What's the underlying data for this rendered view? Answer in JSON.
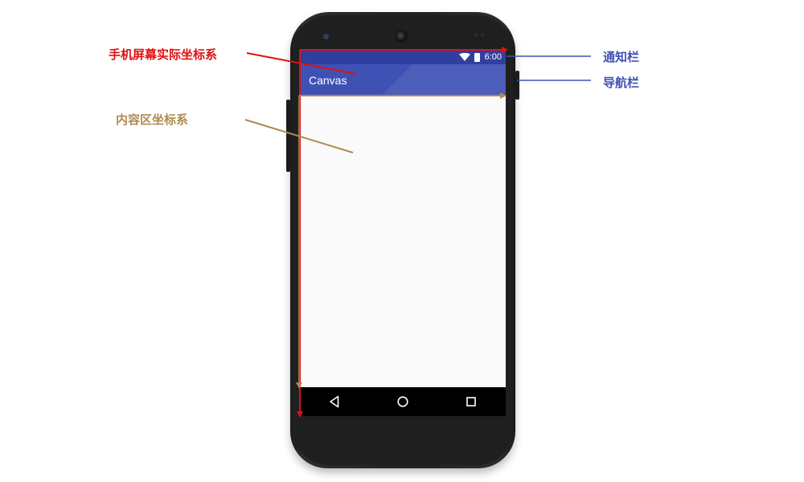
{
  "annotations": {
    "screen_coordinate_system": "手机屏幕实际坐标系",
    "content_coordinate_system": "内容区坐标系",
    "notification_bar": "通知栏",
    "navigation_bar": "导航栏"
  },
  "phone": {
    "status_bar": {
      "time": "6:00",
      "icons": [
        "wifi-icon",
        "battery-icon"
      ]
    },
    "toolbar": {
      "title": "Canvas"
    },
    "nav_bar": {
      "buttons": [
        "back-icon",
        "home-icon",
        "recents-icon"
      ]
    }
  },
  "colors": {
    "screen_axis": "#e01010",
    "content_axis": "#b08a50",
    "bar_label": "#3f51b5",
    "status_bar": "#303f9f",
    "toolbar": "#3f51b5"
  }
}
